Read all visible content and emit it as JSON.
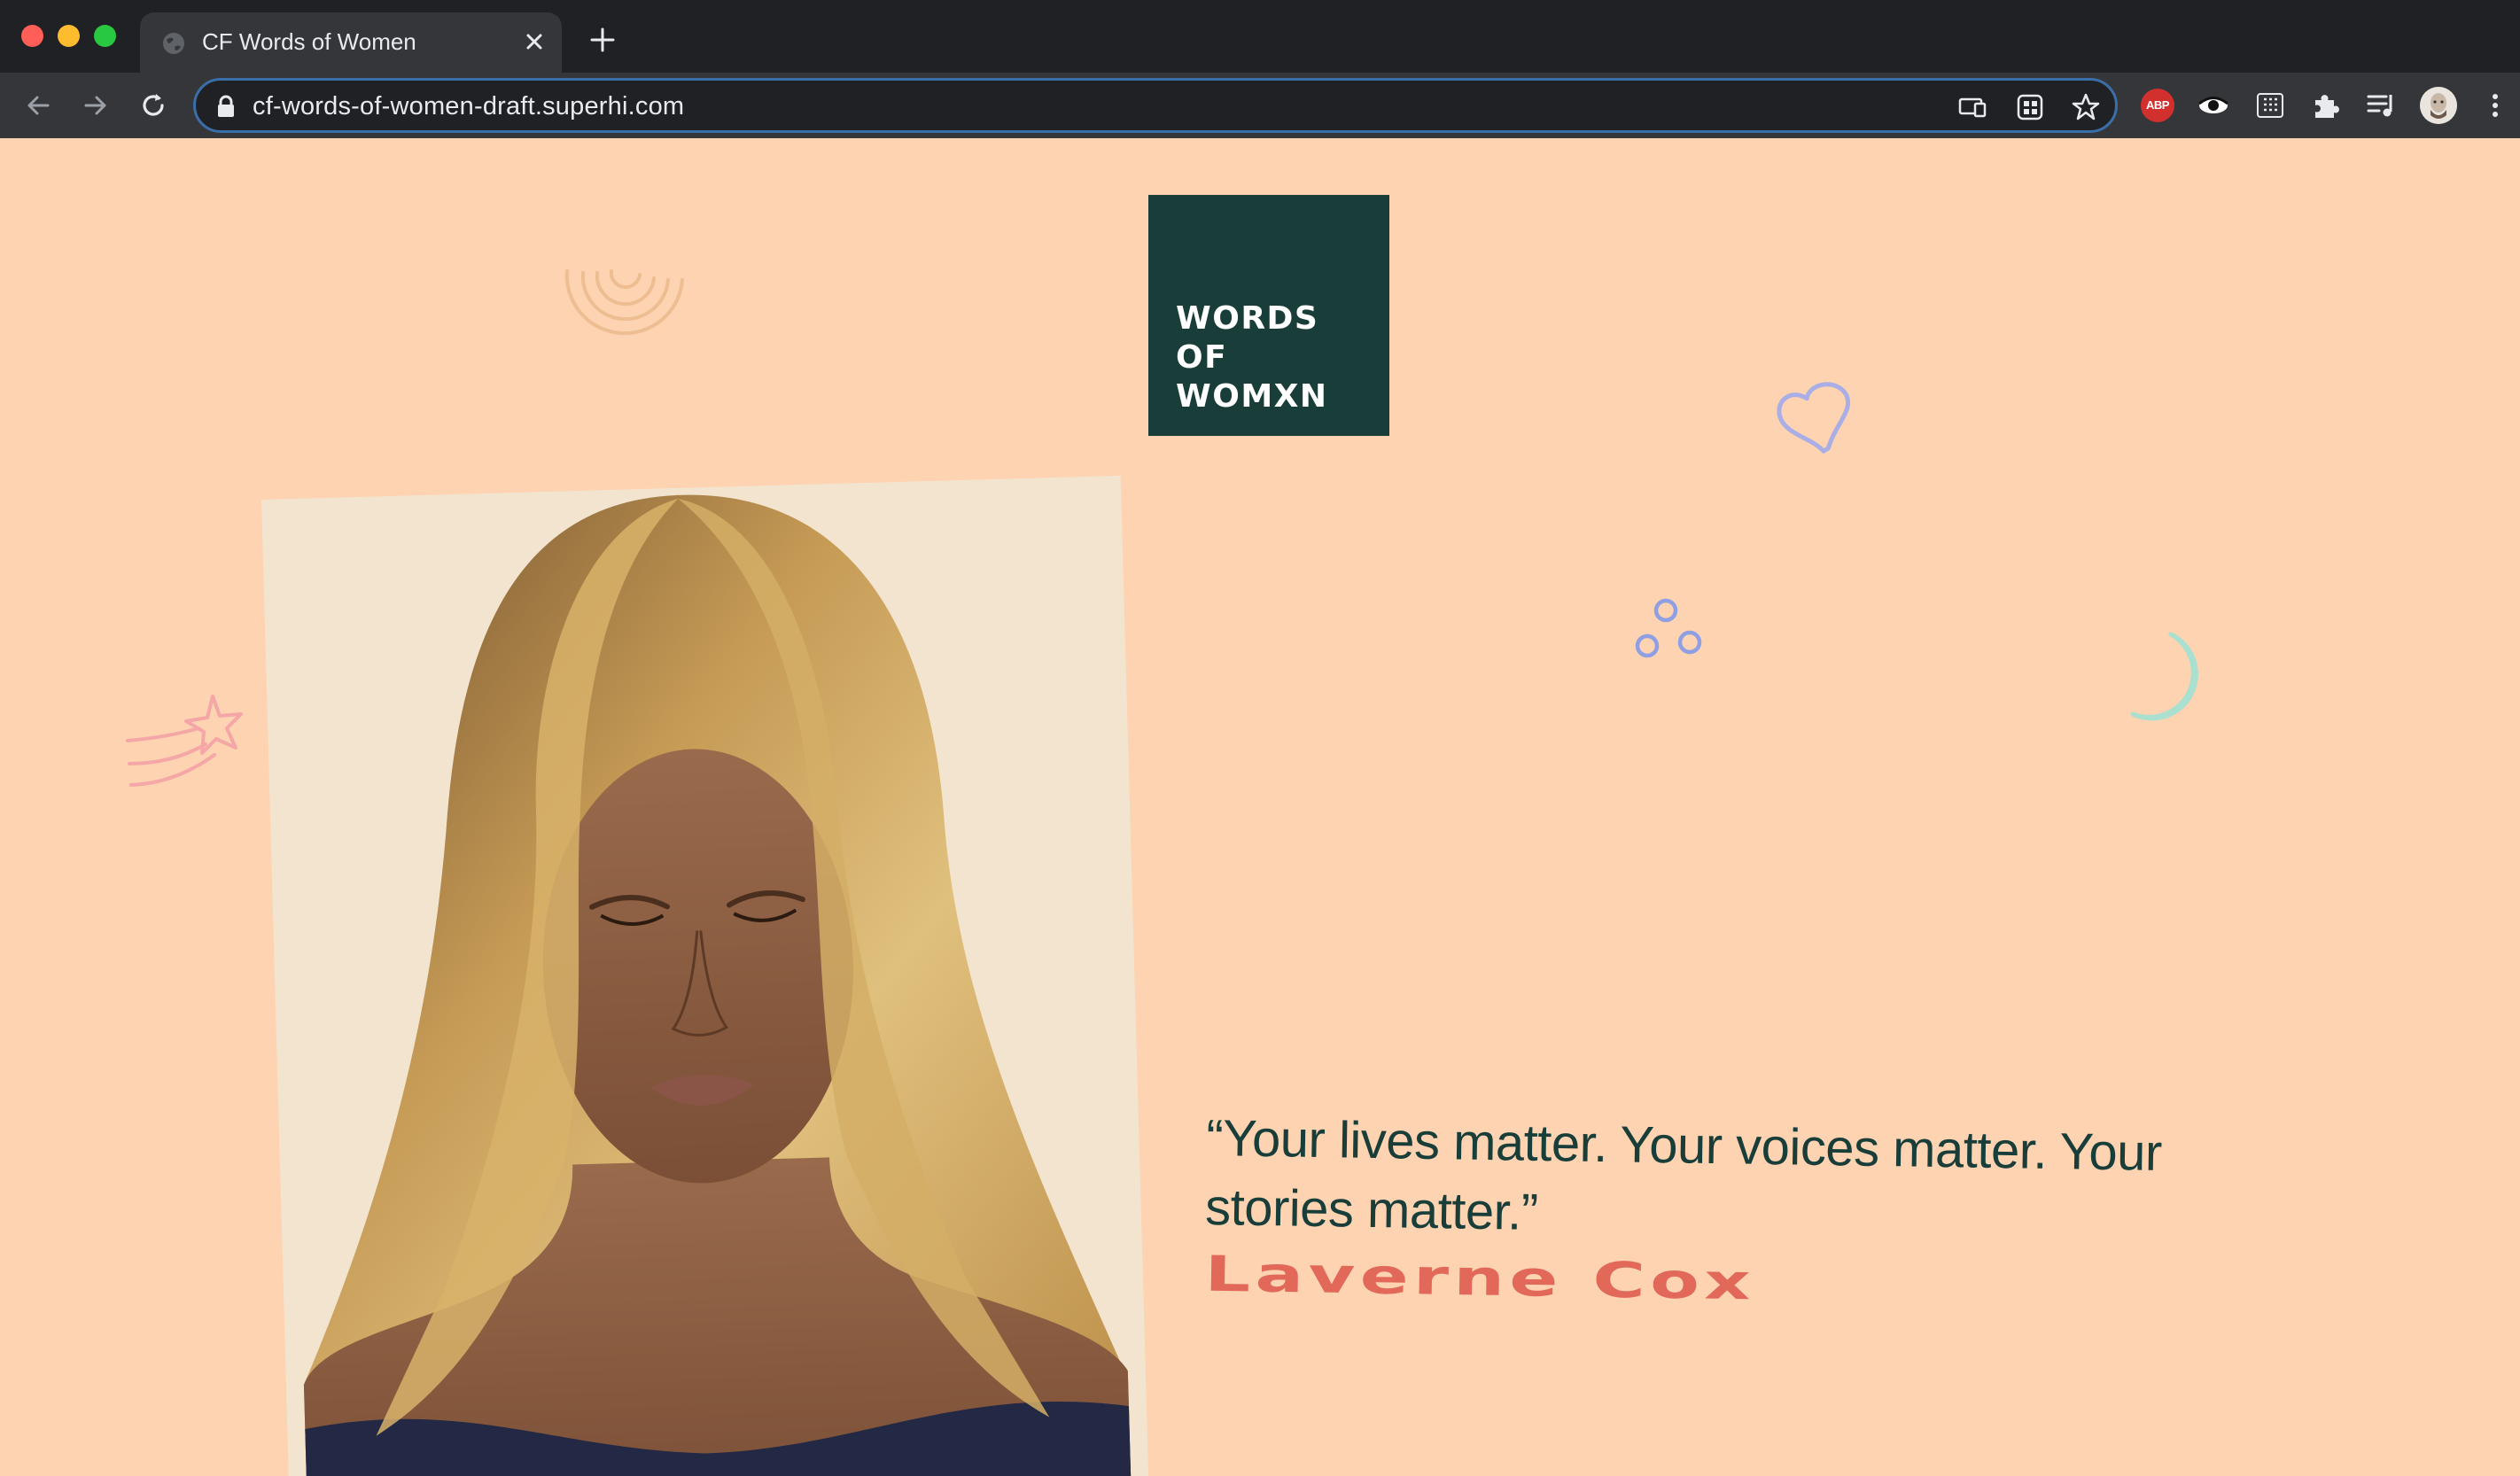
{
  "browser": {
    "tab_title": "CF Words of Women",
    "url": "cf-words-of-women-draft.superhi.com",
    "extensions": [
      "adblock-plus",
      "eye-extension",
      "grid-extension",
      "puzzle-extensions",
      "media-control",
      "profile-avatar"
    ],
    "abp_label": "ABP"
  },
  "site": {
    "logo_lines": [
      "WORDS",
      "OF",
      "WOMXN"
    ],
    "quote": "“Your lives matter. Your voices matter. Your stories matter.”",
    "author": "Laverne Cox"
  },
  "colors": {
    "page_background": "#fdd3b1",
    "logo_background": "#193e3a",
    "quote_text": "#193e3a",
    "author_text": "#e2695a",
    "photo_background": "#f3e4cf"
  },
  "doodles": [
    "rainbow-doodle",
    "heart-doodle",
    "bubbles-doodle",
    "moon-doodle",
    "shooting-star-doodle"
  ]
}
